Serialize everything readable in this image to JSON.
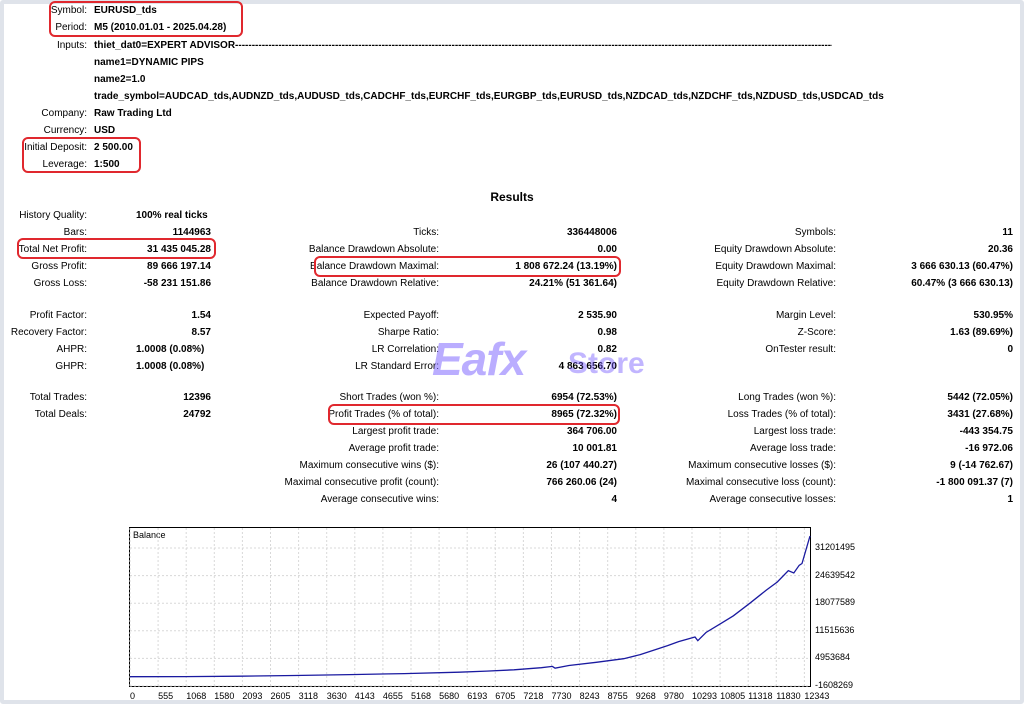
{
  "header": {
    "symbol_label": "Symbol:",
    "symbol": "EURUSD_tds",
    "period_label": "Period:",
    "period": "M5 (2010.01.01 - 2025.04.28)",
    "inputs_label": "Inputs:",
    "input_1": "thiet_dat0=EXPERT ADVISOR--------------------------------------------------------------------------------------------------------------------------------------------------------------------------------------------",
    "input_2": "name1=DYNAMIC PIPS",
    "input_3": "name2=1.0",
    "input_4": "trade_symbol=AUDCAD_tds,AUDNZD_tds,AUDUSD_tds,CADCHF_tds,EURCHF_tds,EURGBP_tds,EURUSD_tds,NZDCAD_tds,NZDCHF_tds,NZDUSD_tds,USDCAD_tds",
    "company_label": "Company:",
    "company": "Raw Trading Ltd",
    "currency_label": "Currency:",
    "currency": "USD",
    "deposit_label": "Initial Deposit:",
    "deposit": "2 500.00",
    "leverage_label": "Leverage:",
    "leverage": "1:500"
  },
  "results_title": "Results",
  "col1": {
    "history_quality_label": "History Quality:",
    "history_quality": "100% real ticks",
    "bars_label": "Bars:",
    "bars": "1144963",
    "net_profit_label": "Total Net Profit:",
    "net_profit": "31 435 045.28",
    "gross_profit_label": "Gross Profit:",
    "gross_profit": "89 666 197.14",
    "gross_loss_label": "Gross Loss:",
    "gross_loss": "-58 231 151.86",
    "profit_factor_label": "Profit Factor:",
    "profit_factor": "1.54",
    "recovery_factor_label": "Recovery Factor:",
    "recovery_factor": "8.57",
    "ahpr_label": "AHPR:",
    "ahpr": "1.0008 (0.08%)",
    "ghpr_label": "GHPR:",
    "ghpr": "1.0008 (0.08%)",
    "total_trades_label": "Total Trades:",
    "total_trades": "12396",
    "total_deals_label": "Total Deals:",
    "total_deals": "24792"
  },
  "col2": {
    "ticks_label": "Ticks:",
    "ticks": "336448006",
    "bal_dd_abs_label": "Balance Drawdown Absolute:",
    "bal_dd_abs": "0.00",
    "bal_dd_max_label": "Balance Drawdown Maximal:",
    "bal_dd_max": "1 808 672.24 (13.19%)",
    "bal_dd_rel_label": "Balance Drawdown Relative:",
    "bal_dd_rel": "24.21% (51 361.64)",
    "exp_payoff_label": "Expected Payoff:",
    "exp_payoff": "2 535.90",
    "sharpe_label": "Sharpe Ratio:",
    "sharpe": "0.98",
    "lr_corr_label": "LR Correlation:",
    "lr_corr": "0.82",
    "lr_err_label": "LR Standard Error:",
    "lr_err": "4 863 656.70",
    "short_label": "Short Trades (won %):",
    "short": "6954 (72.53%)",
    "profit_trades_label": "Profit Trades (% of total):",
    "profit_trades": "8965 (72.32%)",
    "largest_profit_label": "Largest profit trade:",
    "largest_profit": "364 706.00",
    "avg_profit_label": "Average profit trade:",
    "avg_profit": "10 001.81",
    "max_cons_wins_label": "Maximum consecutive wins ($):",
    "max_cons_wins": "26 (107 440.27)",
    "max_cons_profit_label": "Maximal consecutive profit (count):",
    "max_cons_profit": "766 260.06 (24)",
    "avg_cons_wins_label": "Average consecutive wins:",
    "avg_cons_wins": "4"
  },
  "col3": {
    "symbols_label": "Symbols:",
    "symbols": "11",
    "eq_dd_abs_label": "Equity Drawdown Absolute:",
    "eq_dd_abs": "20.36",
    "eq_dd_max_label": "Equity Drawdown Maximal:",
    "eq_dd_max": "3 666 630.13 (60.47%)",
    "eq_dd_rel_label": "Equity Drawdown Relative:",
    "eq_dd_rel": "60.47% (3 666 630.13)",
    "margin_label": "Margin Level:",
    "margin": "530.95%",
    "zscore_label": "Z-Score:",
    "zscore": "1.63 (89.69%)",
    "ontester_label": "OnTester result:",
    "ontester": "0",
    "long_label": "Long Trades (won %):",
    "long": "5442 (72.05%)",
    "loss_trades_label": "Loss Trades (% of total):",
    "loss_trades": "3431 (27.68%)",
    "largest_loss_label": "Largest loss trade:",
    "largest_loss": "-443 354.75",
    "avg_loss_label": "Average loss trade:",
    "avg_loss": "-16 972.06",
    "max_cons_losses_label": "Maximum consecutive losses ($):",
    "max_cons_losses": "9 (-14 762.67)",
    "max_cons_loss_label": "Maximal consecutive loss (count):",
    "max_cons_loss": "-1 800 091.37 (7)",
    "avg_cons_losses_label": "Average consecutive losses:",
    "avg_cons_losses": "1"
  },
  "watermark": {
    "main": "Eafx",
    "suffix": "Store"
  },
  "chart_data": {
    "type": "line",
    "title": "Balance",
    "x_ticks": [
      "0",
      "555",
      "1068",
      "1580",
      "2093",
      "2605",
      "3118",
      "3630",
      "4143",
      "4655",
      "5168",
      "5680",
      "6193",
      "6705",
      "7218",
      "7730",
      "8243",
      "8755",
      "9268",
      "9780",
      "10293",
      "10805",
      "11318",
      "11830",
      "12343"
    ],
    "y_ticks": [
      "31201495",
      "24639542",
      "18077589",
      "11515636",
      "4953684",
      "-1608269"
    ],
    "ylim": [
      -1608269,
      31201495
    ],
    "xlim": [
      0,
      12396
    ],
    "series": [
      {
        "color": "#1a1aa0",
        "x": [
          0,
          1000,
          2000,
          3000,
          4000,
          5000,
          6000,
          6500,
          7000,
          7500,
          7700,
          7750,
          8000,
          8500,
          9000,
          9300,
          9600,
          9800,
          10000,
          10300,
          10350,
          10500,
          10800,
          11000,
          11300,
          11600,
          11800,
          12000,
          12100,
          12200,
          12250,
          12396
        ],
        "y": [
          2500,
          30000,
          120000,
          280000,
          480000,
          700000,
          1000000,
          1250000,
          1550000,
          2000000,
          2300000,
          1900000,
          2500000,
          3200000,
          4000000,
          4900000,
          6100000,
          6900000,
          7800000,
          8800000,
          8000000,
          9800000,
          12000000,
          13500000,
          16300000,
          19200000,
          21000000,
          23500000,
          23000000,
          24700000,
          25100000,
          31201495
        ]
      }
    ],
    "grid": true
  }
}
